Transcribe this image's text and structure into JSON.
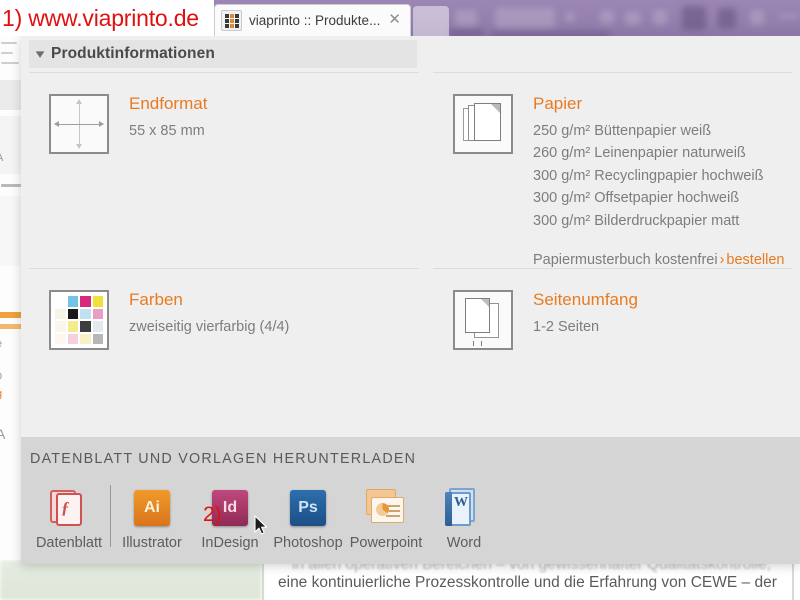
{
  "annotations": {
    "step1_label": "1) www.viaprinto.de",
    "step2_label": "2)"
  },
  "browser": {
    "tab": {
      "title": "viaprinto :: Produkte...",
      "close_icon": "close-icon",
      "favicon": "viaprinto-favicon"
    }
  },
  "panel": {
    "section_header": {
      "chevron_icon": "chevron-down-icon",
      "label": "Produktinformationen"
    },
    "items": [
      {
        "icon": "format-crosshair-icon",
        "title": "Endformat",
        "lines": [
          "55 x 85 mm"
        ]
      },
      {
        "icon": "paper-stack-icon",
        "title": "Papier",
        "lines": [
          "250 g/m² Büttenpapier weiß",
          "260 g/m² Leinenpapier naturweiß",
          "300 g/m² Recyclingpapier hochweiß",
          "300 g/m² Offsetpapier hochweiß",
          "300 g/m² Bilderdruckpapier matt"
        ],
        "order_note": "Papiermusterbuch kostenfrei",
        "order_arrow": "›",
        "order_link": "bestellen"
      },
      {
        "icon": "color-swatches-icon",
        "title": "Farben",
        "lines": [
          "zweiseitig vierfarbig (4/4)"
        ]
      },
      {
        "icon": "pages-icon",
        "title": "Seitenumfang",
        "lines": [
          "1-2 Seiten"
        ]
      }
    ],
    "color_swatches": [
      "#ffffff",
      "#6fc5e3",
      "#d7297e",
      "#f2e03a",
      "#f6f3e7",
      "#1a1a1a",
      "#bfe2f1",
      "#eb9ec4",
      "#fcf6ea",
      "#f4eb8c",
      "#3d3d3d",
      "#e3eaee",
      "#fdf7ef",
      "#f6cfe0",
      "#f6f2c6",
      "#b7b7b7"
    ]
  },
  "download": {
    "title": "DATENBLATT UND VORLAGEN HERUNTERLADEN",
    "items": [
      {
        "icon": "pdf-datasheet-icon",
        "label": "Datenblatt",
        "glyph": ""
      },
      {
        "icon": "illustrator-icon",
        "label": "Illustrator",
        "glyph": "Ai"
      },
      {
        "icon": "indesign-icon",
        "label": "InDesign",
        "glyph": "Id"
      },
      {
        "icon": "photoshop-icon",
        "label": "Photoshop",
        "glyph": "Ps"
      },
      {
        "icon": "powerpoint-icon",
        "label": "Powerpoint",
        "glyph": ""
      },
      {
        "icon": "word-icon",
        "label": "Word",
        "glyph": "W"
      }
    ]
  },
  "background_page": {
    "body_text": "eine kontinuierliche Prozesskontrolle und die Erfahrung von CEWE – der",
    "body_text_faded": "in allen operativen Bereichen – von gewissenhafter Qualitätskontrolle,"
  },
  "colors": {
    "accent_orange": "#e87b22",
    "annotation_red": "#e0100f",
    "panel_bg": "#efefef",
    "download_bg": "#d5d5d5",
    "chrome_purple": "#9580ae"
  }
}
